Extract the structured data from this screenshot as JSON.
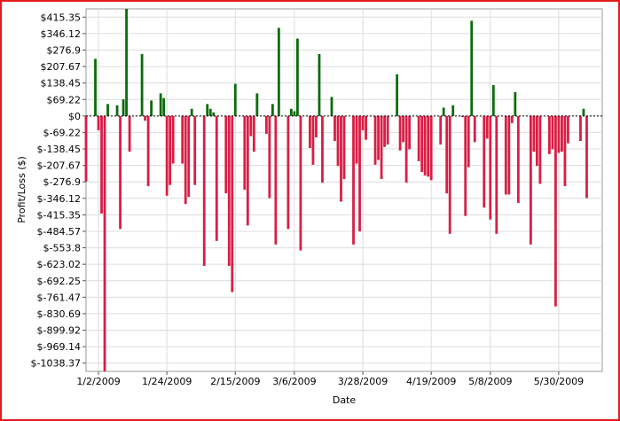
{
  "chart_data": {
    "type": "bar",
    "xlabel": "Date",
    "ylabel": "Profit/Loss ($)",
    "ylim": [
      -1073.0,
      450.0
    ],
    "y_ticks": [
      415.35,
      346.12,
      276.9,
      207.67,
      138.45,
      69.22,
      0,
      -69.22,
      -138.45,
      -207.67,
      -276.9,
      -346.12,
      -415.35,
      -484.57,
      -553.8,
      -623.02,
      -692.25,
      -761.47,
      -830.69,
      -899.92,
      -969.14,
      -1038.37
    ],
    "y_tick_labels": [
      "$415.35",
      "$346.12",
      "$276.9",
      "$207.67",
      "$138.45",
      "$69.22",
      "$0",
      "$-69.22",
      "$-138.45",
      "$-207.67",
      "$-276.9",
      "$-346.12",
      "$-415.35",
      "$-484.57",
      "$-553.8",
      "$-623.02",
      "$-692.25",
      "$-761.47",
      "$-830.69",
      "$-899.92",
      "$-969.14",
      "$-1038.37"
    ],
    "x_range": [
      "2008-12-29",
      "2009-06-13"
    ],
    "x_ticks": [
      "2009-01-02",
      "2009-01-24",
      "2009-02-15",
      "2009-03-06",
      "2009-03-28",
      "2009-04-19",
      "2009-05-08",
      "2009-05-30"
    ],
    "x_tick_labels": [
      "1/2/2009",
      "1/24/2009",
      "2/15/2009",
      "3/6/2009",
      "3/28/2009",
      "4/19/2009",
      "5/8/2009",
      "5/30/2009"
    ],
    "grid": true,
    "colors": {
      "profit": "#0b6b0b",
      "loss": "#d81e45",
      "grid": "#dcdcdc",
      "zero_line": "#000000",
      "frame": "#e21b1b"
    },
    "points": [
      {
        "x": "2008-12-29",
        "y": -276
      },
      {
        "x": "2009-01-01",
        "y": 240
      },
      {
        "x": "2009-01-02",
        "y": -60
      },
      {
        "x": "2009-01-03",
        "y": -410
      },
      {
        "x": "2009-01-04",
        "y": -1073
      },
      {
        "x": "2009-01-05",
        "y": 50
      },
      {
        "x": "2009-01-08",
        "y": 45
      },
      {
        "x": "2009-01-09",
        "y": -475
      },
      {
        "x": "2009-01-10",
        "y": 70
      },
      {
        "x": "2009-01-11",
        "y": 450
      },
      {
        "x": "2009-01-12",
        "y": -150
      },
      {
        "x": "2009-01-16",
        "y": 260
      },
      {
        "x": "2009-01-17",
        "y": -20
      },
      {
        "x": "2009-01-18",
        "y": -295
      },
      {
        "x": "2009-01-19",
        "y": 65
      },
      {
        "x": "2009-01-22",
        "y": 95
      },
      {
        "x": "2009-01-23",
        "y": 75
      },
      {
        "x": "2009-01-24",
        "y": -335
      },
      {
        "x": "2009-01-25",
        "y": -290
      },
      {
        "x": "2009-01-26",
        "y": -200
      },
      {
        "x": "2009-01-29",
        "y": -200
      },
      {
        "x": "2009-01-30",
        "y": -370
      },
      {
        "x": "2009-01-31",
        "y": -340
      },
      {
        "x": "2009-02-01",
        "y": 30
      },
      {
        "x": "2009-02-02",
        "y": -290
      },
      {
        "x": "2009-02-05",
        "y": -630
      },
      {
        "x": "2009-02-06",
        "y": 50
      },
      {
        "x": "2009-02-07",
        "y": 30
      },
      {
        "x": "2009-02-08",
        "y": 15
      },
      {
        "x": "2009-02-09",
        "y": -525
      },
      {
        "x": "2009-02-12",
        "y": -325
      },
      {
        "x": "2009-02-13",
        "y": -630
      },
      {
        "x": "2009-02-14",
        "y": -740
      },
      {
        "x": "2009-02-15",
        "y": 135
      },
      {
        "x": "2009-02-18",
        "y": -310
      },
      {
        "x": "2009-02-19",
        "y": -460
      },
      {
        "x": "2009-02-20",
        "y": -85
      },
      {
        "x": "2009-02-21",
        "y": -150
      },
      {
        "x": "2009-02-22",
        "y": 95
      },
      {
        "x": "2009-02-25",
        "y": -75
      },
      {
        "x": "2009-02-26",
        "y": -345
      },
      {
        "x": "2009-02-27",
        "y": 50
      },
      {
        "x": "2009-02-28",
        "y": -540
      },
      {
        "x": "2009-03-01",
        "y": 370
      },
      {
        "x": "2009-03-04",
        "y": -475
      },
      {
        "x": "2009-03-05",
        "y": 30
      },
      {
        "x": "2009-03-06",
        "y": 20
      },
      {
        "x": "2009-03-07",
        "y": 325
      },
      {
        "x": "2009-03-08",
        "y": -565
      },
      {
        "x": "2009-03-11",
        "y": -135
      },
      {
        "x": "2009-03-12",
        "y": -205
      },
      {
        "x": "2009-03-13",
        "y": -90
      },
      {
        "x": "2009-03-14",
        "y": 260
      },
      {
        "x": "2009-03-15",
        "y": -280
      },
      {
        "x": "2009-03-18",
        "y": 80
      },
      {
        "x": "2009-03-19",
        "y": -105
      },
      {
        "x": "2009-03-20",
        "y": -210
      },
      {
        "x": "2009-03-21",
        "y": -360
      },
      {
        "x": "2009-03-22",
        "y": -265
      },
      {
        "x": "2009-03-25",
        "y": -540
      },
      {
        "x": "2009-03-26",
        "y": -200
      },
      {
        "x": "2009-03-27",
        "y": -485
      },
      {
        "x": "2009-03-28",
        "y": -60
      },
      {
        "x": "2009-03-29",
        "y": -100
      },
      {
        "x": "2009-04-01",
        "y": -205
      },
      {
        "x": "2009-04-02",
        "y": -185
      },
      {
        "x": "2009-04-03",
        "y": -265
      },
      {
        "x": "2009-04-04",
        "y": -130
      },
      {
        "x": "2009-04-05",
        "y": -120
      },
      {
        "x": "2009-04-08",
        "y": 175
      },
      {
        "x": "2009-04-09",
        "y": -145
      },
      {
        "x": "2009-04-10",
        "y": -110
      },
      {
        "x": "2009-04-11",
        "y": -280
      },
      {
        "x": "2009-04-12",
        "y": -140
      },
      {
        "x": "2009-04-15",
        "y": -190
      },
      {
        "x": "2009-04-16",
        "y": -235
      },
      {
        "x": "2009-04-17",
        "y": -250
      },
      {
        "x": "2009-04-18",
        "y": -255
      },
      {
        "x": "2009-04-19",
        "y": -270
      },
      {
        "x": "2009-04-22",
        "y": -120
      },
      {
        "x": "2009-04-23",
        "y": 35
      },
      {
        "x": "2009-04-24",
        "y": -325
      },
      {
        "x": "2009-04-25",
        "y": -495
      },
      {
        "x": "2009-04-26",
        "y": 45
      },
      {
        "x": "2009-04-29",
        "y": -5
      },
      {
        "x": "2009-04-30",
        "y": -420
      },
      {
        "x": "2009-05-01",
        "y": -215
      },
      {
        "x": "2009-05-02",
        "y": 400
      },
      {
        "x": "2009-05-03",
        "y": -110
      },
      {
        "x": "2009-05-06",
        "y": -385
      },
      {
        "x": "2009-05-07",
        "y": -95
      },
      {
        "x": "2009-05-08",
        "y": -435
      },
      {
        "x": "2009-05-09",
        "y": 130
      },
      {
        "x": "2009-05-10",
        "y": -495
      },
      {
        "x": "2009-05-13",
        "y": -330
      },
      {
        "x": "2009-05-14",
        "y": -330
      },
      {
        "x": "2009-05-15",
        "y": -30
      },
      {
        "x": "2009-05-16",
        "y": 100
      },
      {
        "x": "2009-05-17",
        "y": -365
      },
      {
        "x": "2009-05-21",
        "y": -540
      },
      {
        "x": "2009-05-22",
        "y": -150
      },
      {
        "x": "2009-05-23",
        "y": -210
      },
      {
        "x": "2009-05-24",
        "y": -285
      },
      {
        "x": "2009-05-27",
        "y": -160
      },
      {
        "x": "2009-05-28",
        "y": -140
      },
      {
        "x": "2009-05-29",
        "y": -800
      },
      {
        "x": "2009-05-30",
        "y": -155
      },
      {
        "x": "2009-05-31",
        "y": -150
      },
      {
        "x": "2009-06-01",
        "y": -295
      },
      {
        "x": "2009-06-02",
        "y": -115
      },
      {
        "x": "2009-06-06",
        "y": -105
      },
      {
        "x": "2009-06-07",
        "y": 30
      },
      {
        "x": "2009-06-08",
        "y": -345
      }
    ]
  }
}
